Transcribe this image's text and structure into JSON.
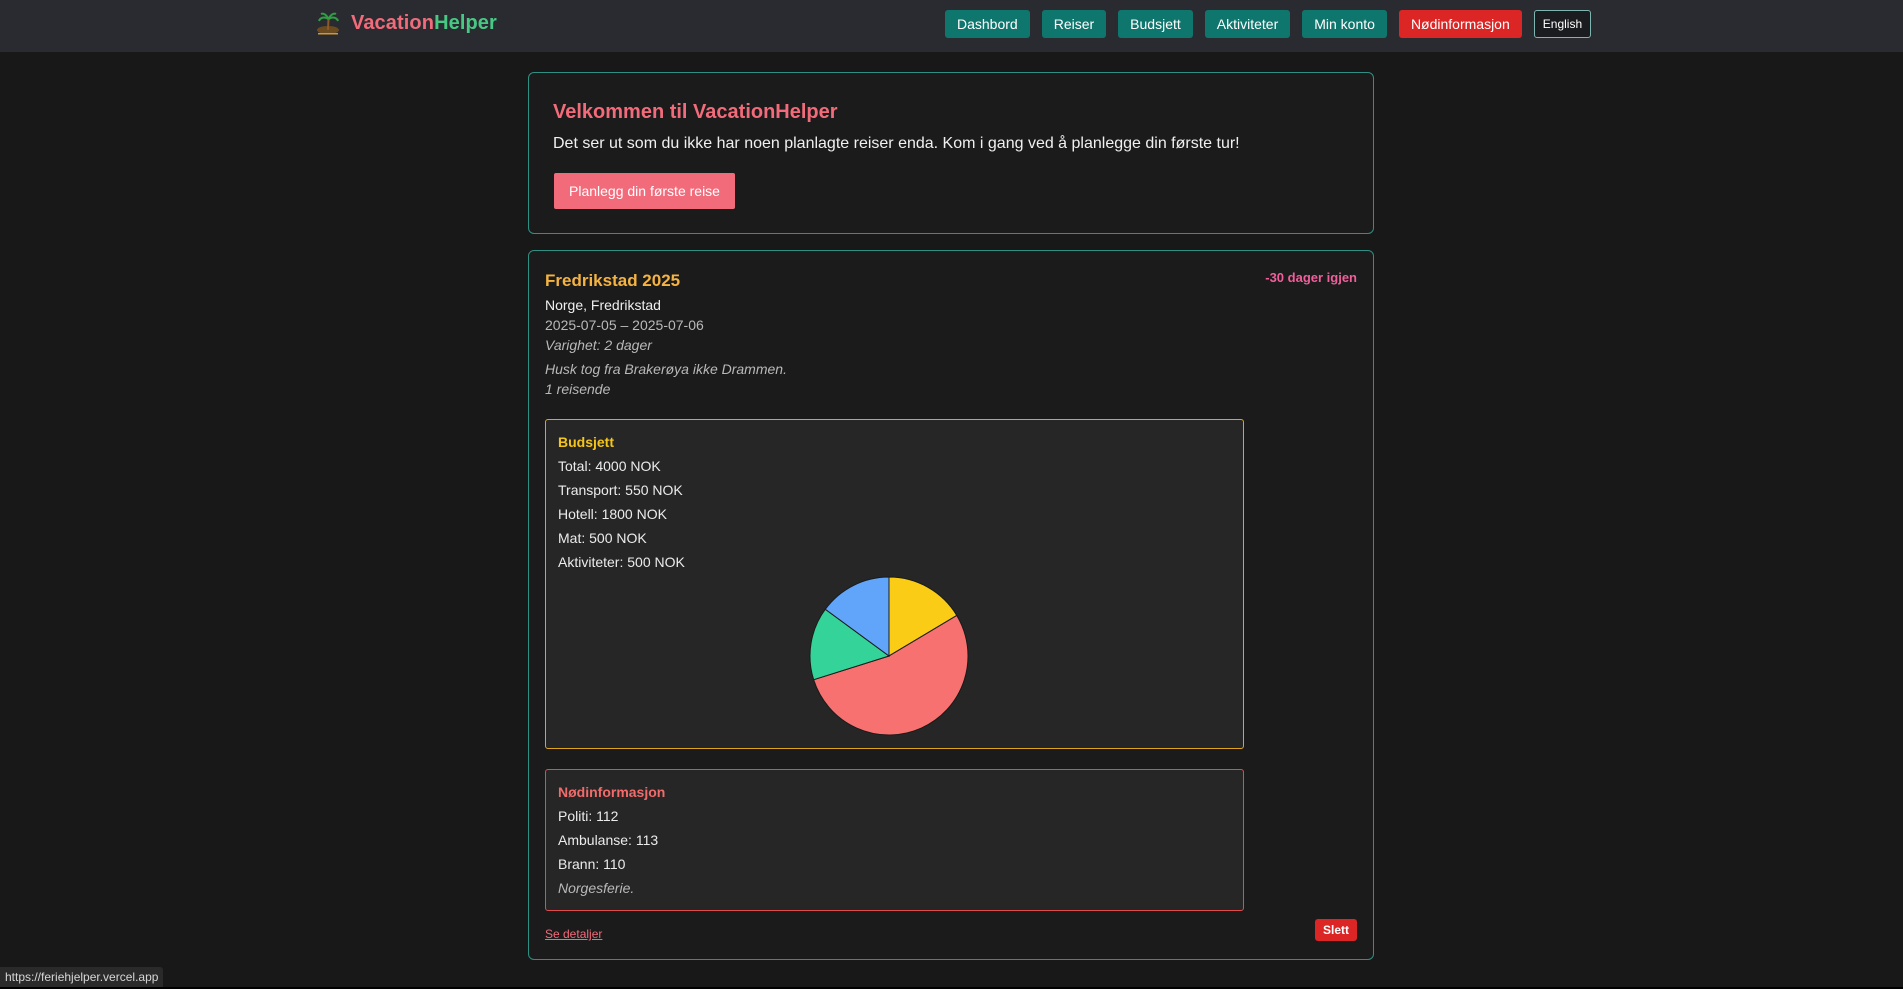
{
  "brand": {
    "name_part1": "Vacation",
    "name_part2": "Helper",
    "logo_icon": "palm-island-logo-icon"
  },
  "nav": {
    "items": [
      "Dashbord",
      "Reiser",
      "Budsjett",
      "Aktiviteter",
      "Min konto"
    ],
    "emergency": "Nødinformasjon",
    "language": "English"
  },
  "welcome": {
    "title": "Velkommen til VacationHelper",
    "text": "Det ser ut som du ikke har noen planlagte reiser enda. Kom i gang ved å planlegge din første tur!",
    "button": "Planlegg din første reise"
  },
  "trip": {
    "title": "Fredrikstad 2025",
    "days_left": "-30 dager igjen",
    "location": "Norge, Fredrikstad",
    "dates": "2025-07-05 – 2025-07-06",
    "duration": "Varighet: 2 dager",
    "note": "Husk tog fra Brakerøya ikke Drammen.",
    "travelers": "1 reisende",
    "budget": {
      "title": "Budsjett",
      "lines": [
        "Total: 4000 NOK",
        "Transport: 550 NOK",
        "Hotell: 1800 NOK",
        "Mat: 500 NOK",
        "Aktiviteter: 500 NOK"
      ]
    },
    "emergency": {
      "title": "Nødinformasjon",
      "lines": [
        "Politi: 112",
        "Ambulanse: 113",
        "Brann: 110"
      ],
      "note": "Norgesferie."
    },
    "details_link": "Se detaljer",
    "delete_button": "Slett"
  },
  "chart_data": {
    "type": "pie",
    "categories": [
      "Transport",
      "Hotell",
      "Mat",
      "Aktiviteter"
    ],
    "values": [
      550,
      1800,
      500,
      500
    ],
    "colors": [
      "#facc15",
      "#f87171",
      "#34d399",
      "#60a5fa"
    ]
  },
  "status_url": "https://feriehjelper.vercel.app",
  "colors": {
    "accent": "#f26b7a",
    "nav_button": "#0f766e",
    "danger": "#dc2626",
    "card_border": "#2f8f83"
  }
}
